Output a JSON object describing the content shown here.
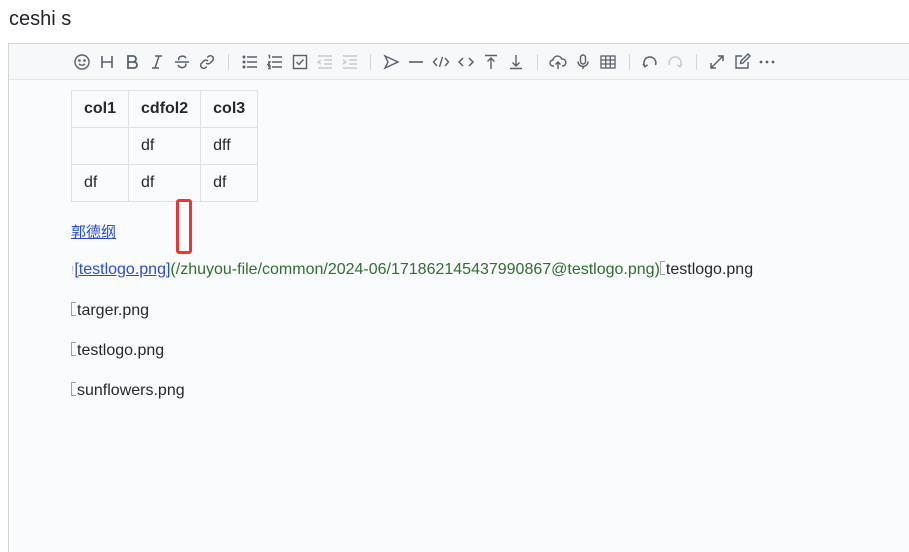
{
  "page": {
    "title": "ceshi s"
  },
  "toolbar": {
    "buttons": [
      {
        "name": "emoji-icon"
      },
      {
        "name": "heading-icon"
      },
      {
        "name": "bold-icon"
      },
      {
        "name": "italic-icon"
      },
      {
        "name": "strike-icon"
      },
      {
        "name": "link-icon"
      },
      {
        "name": "list-icon"
      },
      {
        "name": "ordered-list-icon"
      },
      {
        "name": "check-icon"
      },
      {
        "name": "outdent-icon"
      },
      {
        "name": "indent-icon"
      },
      {
        "name": "quote-icon"
      },
      {
        "name": "line-icon"
      },
      {
        "name": "code-icon"
      },
      {
        "name": "inline-code-icon"
      },
      {
        "name": "insert-before-icon"
      },
      {
        "name": "insert-after-icon"
      },
      {
        "name": "upload-icon"
      },
      {
        "name": "record-icon"
      },
      {
        "name": "table-icon"
      },
      {
        "name": "undo-icon"
      },
      {
        "name": "redo-icon"
      },
      {
        "name": "fullscreen-icon"
      },
      {
        "name": "edit-mode-icon"
      },
      {
        "name": "more-icon"
      }
    ]
  },
  "table": {
    "headers": [
      "col1",
      "cdfol2",
      "col3"
    ],
    "rows": [
      [
        "",
        "df",
        "dff"
      ],
      [
        "df",
        "df",
        "df"
      ]
    ]
  },
  "link_cn": "郭德纲",
  "md_line": {
    "marker": "!",
    "link_text": "[testlogo.png]",
    "path": "(/zhuyou-file/common/2024-06/17186214543799086​7@testlogo.png)",
    "img_alt": "testlogo.png"
  },
  "images": [
    "targer.png",
    "testlogo.png",
    "sunflowers.png"
  ],
  "colors": {
    "link": "#2a4bd7",
    "path": "#2f6f2f",
    "highlight": "#e53935"
  }
}
